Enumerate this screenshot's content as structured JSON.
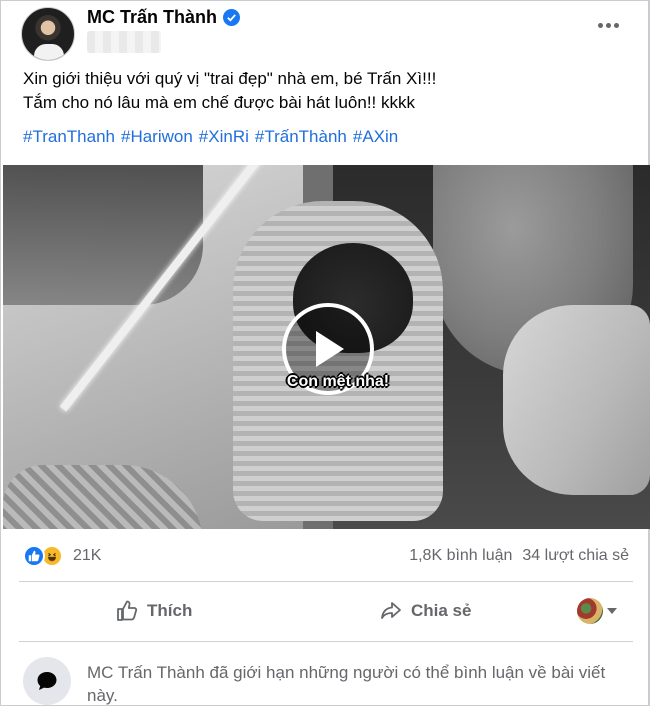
{
  "post": {
    "author": "MC Trấn Thành",
    "text_line1": "Xin giới thiệu với quý vị \"trai đẹp\" nhà em, bé Trấn Xì!!!",
    "text_line2": "Tắm cho nó lâu mà em chế được bài hát luôn!! kkkk",
    "hashtags": [
      "#TranThanh",
      "#Hariwon",
      "#XinRi",
      "#TrấnThành",
      "#AXin"
    ]
  },
  "video": {
    "caption": "Con mệt nha!"
  },
  "stats": {
    "reaction_count": "21K",
    "comments": "1,8K bình luận",
    "shares": "34 lượt chia sẻ"
  },
  "actions": {
    "like_label": "Thích",
    "share_label": "Chia sẻ"
  },
  "notice": {
    "text": "MC Trấn Thành đã giới hạn những người có thể bình luận về bài viết này."
  },
  "colors": {
    "link_blue": "#216fdb",
    "verified_blue": "#1877f2",
    "muted_text": "#65676b",
    "haha_yellow": "#f7b928"
  },
  "icons": [
    "verified-badge-icon",
    "more-options-icon",
    "play-icon",
    "like-reaction-icon",
    "haha-reaction-icon",
    "thumbs-up-icon",
    "share-arrow-icon",
    "chevron-down-icon",
    "comment-bubble-icon"
  ]
}
